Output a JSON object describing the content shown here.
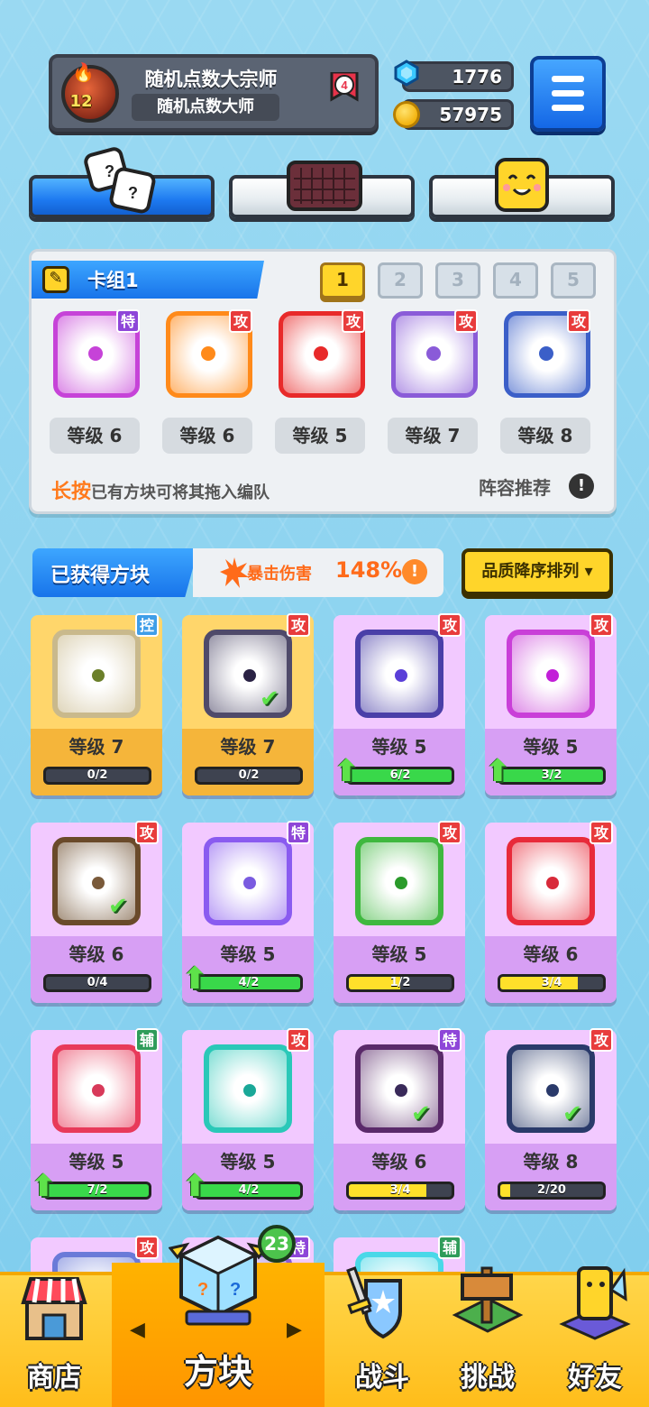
{
  "profile": {
    "title": "随机点数大宗师",
    "subtitle": "随机点数大师",
    "level": "12",
    "rank": "4"
  },
  "currency": {
    "gems": "1776",
    "coins": "57975"
  },
  "deck": {
    "name": "卡组1",
    "slots": [
      "1",
      "2",
      "3",
      "4",
      "5"
    ],
    "cards": [
      {
        "badge": "特",
        "level": "等级 6",
        "color": "#c643d8"
      },
      {
        "badge": "攻",
        "level": "等级 6",
        "color": "#ff8a1a"
      },
      {
        "badge": "攻",
        "level": "等级 5",
        "color": "#e82a2a"
      },
      {
        "badge": "攻",
        "level": "等级 7",
        "color": "#8a5bd8"
      },
      {
        "badge": "攻",
        "level": "等级 8",
        "color": "#3b5fc8"
      }
    ],
    "hint_strong": "长按",
    "hint_rest": "已有方块可将其拖入编队",
    "recommend": "阵容推荐"
  },
  "acquired": {
    "title": "已获得方块",
    "crit_label": "暴击伤害",
    "crit_value": "148%",
    "sort": "品质降序排列"
  },
  "grid": [
    {
      "badge": "控",
      "level": "等级 7",
      "progress": "0/2",
      "fill": 0,
      "bar": "#3e4350",
      "icon": "#c9b98c",
      "dot": "#6b7f2a",
      "gold": true,
      "up": false,
      "check": false
    },
    {
      "badge": "攻",
      "level": "等级 7",
      "progress": "0/2",
      "fill": 0,
      "bar": "#3e4350",
      "icon": "#4f4a6a",
      "dot": "#2a2244",
      "gold": true,
      "up": false,
      "check": true
    },
    {
      "badge": "攻",
      "level": "等级 5",
      "progress": "6/2",
      "fill": 1,
      "bar": "#39d84a",
      "icon": "#4a3fa8",
      "dot": "#5a3fd8",
      "gold": false,
      "up": true,
      "check": false
    },
    {
      "badge": "攻",
      "level": "等级 5",
      "progress": "3/2",
      "fill": 1,
      "bar": "#39d84a",
      "icon": "#c93fd8",
      "dot": "#c21fd8",
      "gold": false,
      "up": true,
      "check": false
    },
    {
      "badge": "攻",
      "level": "等级 6",
      "progress": "0/4",
      "fill": 0,
      "bar": "#3e4350",
      "icon": "#6a4a2a",
      "dot": "#7a5a3a",
      "gold": false,
      "up": false,
      "check": true
    },
    {
      "badge": "特",
      "level": "等级 5",
      "progress": "4/2",
      "fill": 1,
      "bar": "#39d84a",
      "icon": "#8a5bf0",
      "dot": "#7a5be0",
      "gold": false,
      "up": true,
      "check": false
    },
    {
      "badge": "攻",
      "level": "等级 5",
      "progress": "1/2",
      "fill": 0.5,
      "bar": "#ffe02a",
      "icon": "#3fb83f",
      "dot": "#2a9a2a",
      "gold": false,
      "up": false,
      "check": false
    },
    {
      "badge": "攻",
      "level": "等级 6",
      "progress": "3/4",
      "fill": 0.75,
      "bar": "#ffe02a",
      "icon": "#e82a3a",
      "dot": "#d82a3a",
      "gold": false,
      "up": false,
      "check": false
    },
    {
      "badge": "辅",
      "level": "等级 5",
      "progress": "7/2",
      "fill": 1,
      "bar": "#39d84a",
      "icon": "#e83a5a",
      "dot": "#d83a5a",
      "gold": false,
      "up": true,
      "check": false
    },
    {
      "badge": "攻",
      "level": "等级 5",
      "progress": "4/2",
      "fill": 1,
      "bar": "#39d84a",
      "icon": "#2ac8b8",
      "dot": "#1aa898",
      "gold": false,
      "up": true,
      "check": false
    },
    {
      "badge": "特",
      "level": "等级 6",
      "progress": "3/4",
      "fill": 0.75,
      "bar": "#ffe02a",
      "icon": "#5a2a6a",
      "dot": "#3a2a5a",
      "gold": false,
      "up": false,
      "check": true
    },
    {
      "badge": "攻",
      "level": "等级 8",
      "progress": "2/20",
      "fill": 0.1,
      "bar": "#ffe02a",
      "icon": "#2a3a6a",
      "dot": "#2a3a6a",
      "gold": false,
      "up": false,
      "check": true
    },
    {
      "badge": "攻",
      "level": "",
      "progress": "",
      "fill": 0,
      "bar": "#3e4350",
      "icon": "#6a7ad8",
      "dot": "#5a6ad8",
      "gold": false,
      "up": false,
      "check": false
    },
    {
      "badge": "特",
      "level": "",
      "progress": "",
      "fill": 0,
      "bar": "#3e4350",
      "icon": "#8a5bd8",
      "dot": "#6a4ab8",
      "gold": false,
      "up": false,
      "check": false
    },
    {
      "badge": "辅",
      "level": "",
      "progress": "",
      "fill": 0,
      "bar": "#3e4350",
      "icon": "#4ad8e8",
      "dot": "#2ab8c8",
      "gold": false,
      "up": false,
      "check": false
    }
  ],
  "nav": {
    "shop": "商店",
    "blocks": "方块",
    "battle": "战斗",
    "challenge": "挑战",
    "friends": "好友",
    "badge": "23"
  }
}
